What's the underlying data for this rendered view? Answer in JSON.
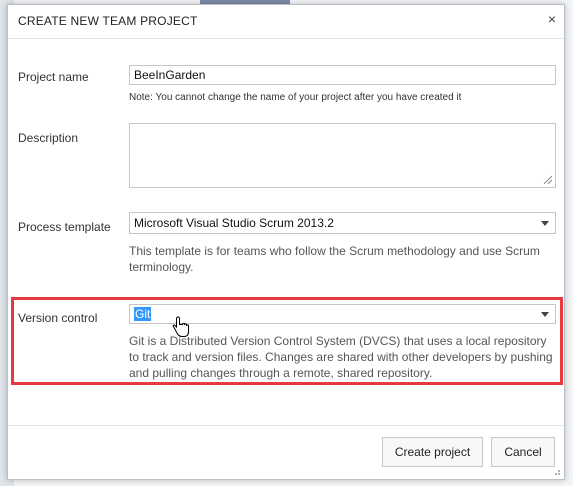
{
  "dialog": {
    "title": "CREATE NEW TEAM PROJECT",
    "close_label": "×"
  },
  "project_name": {
    "label": "Project name",
    "value": "BeeInGarden",
    "note": "Note: You cannot change the name of your project after you have created it"
  },
  "description": {
    "label": "Description",
    "value": ""
  },
  "process_template": {
    "label": "Process template",
    "selected": "Microsoft Visual Studio Scrum 2013.2",
    "help": "This template is for teams who follow the Scrum methodology and use Scrum terminology."
  },
  "version_control": {
    "label": "Version control",
    "selected": "Git",
    "help": "Git is a Distributed Version Control System (DVCS) that uses a local repository to track and version files. Changes are shared with other developers by pushing and pulling changes through a remote, shared repository."
  },
  "buttons": {
    "create": "Create project",
    "cancel": "Cancel"
  },
  "colors": {
    "highlight": "#e63a40",
    "selection": "#3399ff"
  }
}
